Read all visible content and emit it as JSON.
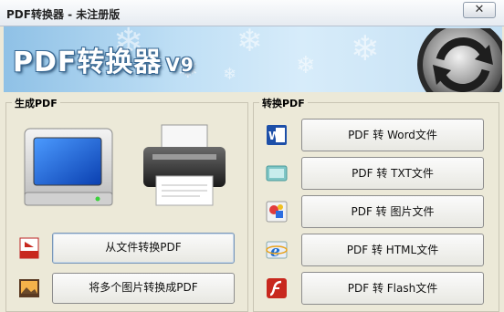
{
  "window": {
    "title": "PDF转换器 - 未注册版",
    "close_label": "✕"
  },
  "banner": {
    "title": "PDF转换器",
    "version": "V9"
  },
  "left_panel": {
    "legend": "生成PDF",
    "buttons": [
      {
        "label": "从文件转换PDF",
        "icon": "pdf-doc-icon"
      },
      {
        "label": "将多个图片转换成PDF",
        "icon": "image-icon"
      }
    ]
  },
  "right_panel": {
    "legend": "转换PDF",
    "buttons": [
      {
        "label": "PDF 转 Word文件",
        "icon": "word-icon"
      },
      {
        "label": "PDF 转 TXT文件",
        "icon": "txt-icon"
      },
      {
        "label": "PDF 转 图片文件",
        "icon": "picture-icon"
      },
      {
        "label": "PDF 转 HTML文件",
        "icon": "ie-icon"
      },
      {
        "label": "PDF 转 Flash文件",
        "icon": "flash-icon"
      }
    ]
  },
  "colors": {
    "background": "#ece9d8",
    "banner_blue": "#8fc1e6",
    "monitor_blue": "#1a5fd6"
  }
}
